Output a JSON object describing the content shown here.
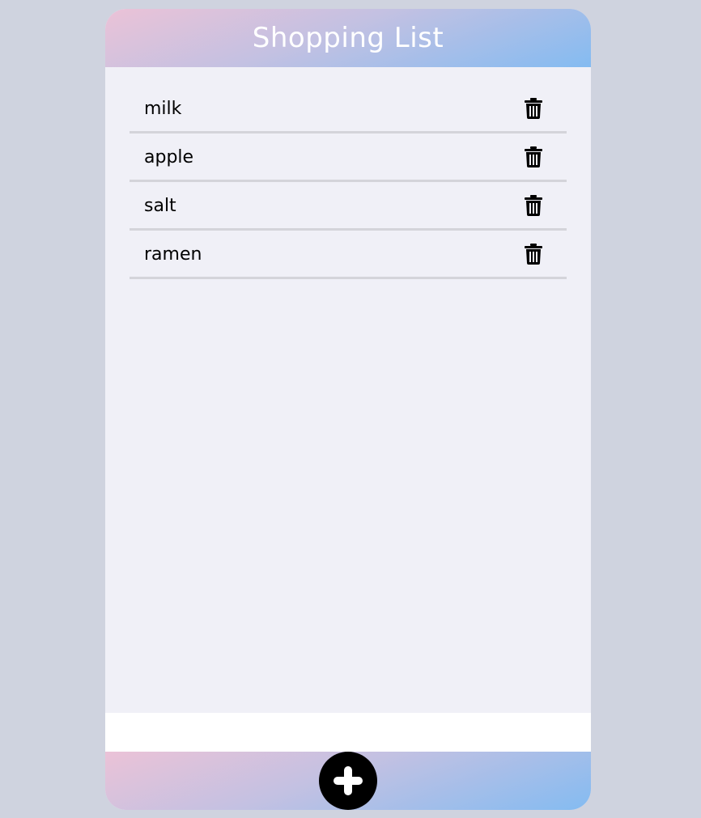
{
  "header": {
    "title": "Shopping List"
  },
  "items": [
    {
      "label": "milk",
      "action_icon": "trash-icon"
    },
    {
      "label": "apple",
      "action_icon": "trash-icon"
    },
    {
      "label": "salt",
      "action_icon": "trash-icon"
    },
    {
      "label": "ramen",
      "action_icon": "trash-icon"
    }
  ],
  "input": {
    "value": "",
    "placeholder": ""
  },
  "footer": {
    "add_icon": "plus-icon"
  },
  "colors": {
    "background": "#cfd3df",
    "panel": "#f0f0f7",
    "gradient_start": "#ebc2d7",
    "gradient_end": "#84bbf1",
    "divider": "#d4d4da"
  }
}
